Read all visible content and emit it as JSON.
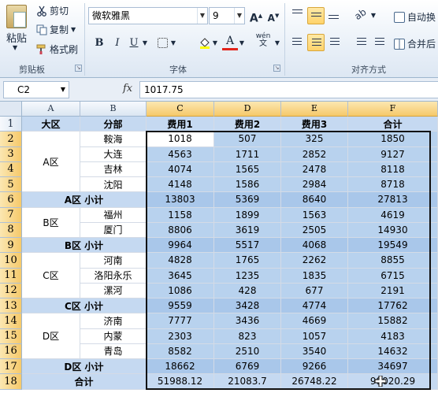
{
  "ribbon": {
    "clipboard": {
      "paste": "粘贴",
      "cut": "剪切",
      "copy": "复制",
      "painter": "格式刷",
      "label": "剪贴板"
    },
    "font": {
      "name": "微软雅黑",
      "size": "9",
      "bold": "B",
      "italic": "I",
      "underline": "U",
      "grow": "A",
      "shrink": "A",
      "label": "字体",
      "wen": "wén"
    },
    "alignment": {
      "wrap": "自动换",
      "merge": "合并后",
      "label": "对齐方式"
    }
  },
  "formula_bar": {
    "name_box": "C2",
    "fx": "fx",
    "value": "1017.75"
  },
  "columns": [
    "A",
    "B",
    "C",
    "D",
    "E",
    "F"
  ],
  "rows": [
    "1",
    "2",
    "3",
    "4",
    "5",
    "6",
    "7",
    "8",
    "9",
    "10",
    "11",
    "12",
    "13",
    "14",
    "15",
    "16",
    "17",
    "18"
  ],
  "header": [
    "大区",
    "分部",
    "费用1",
    "费用2",
    "费用3",
    "合计"
  ],
  "regions": [
    "A区",
    "B区",
    "C区",
    "D区"
  ],
  "body": [
    [
      "",
      "鞍海",
      "1018",
      "507",
      "325",
      "1850"
    ],
    [
      "",
      "大连",
      "4563",
      "1711",
      "2852",
      "9127"
    ],
    [
      "",
      "吉林",
      "4074",
      "1565",
      "2478",
      "8118"
    ],
    [
      "",
      "沈阳",
      "4148",
      "1586",
      "2984",
      "8718"
    ],
    [
      "A区 小计",
      "",
      "13803",
      "5369",
      "8640",
      "27813"
    ],
    [
      "",
      "福州",
      "1158",
      "1899",
      "1563",
      "4619"
    ],
    [
      "",
      "厦门",
      "8806",
      "3619",
      "2505",
      "14930"
    ],
    [
      "B区 小计",
      "",
      "9964",
      "5517",
      "4068",
      "19549"
    ],
    [
      "",
      "河南",
      "4828",
      "1765",
      "2262",
      "8855"
    ],
    [
      "",
      "洛阳永乐",
      "3645",
      "1235",
      "1835",
      "6715"
    ],
    [
      "",
      "漯河",
      "1086",
      "428",
      "677",
      "2191"
    ],
    [
      "C区 小计",
      "",
      "9559",
      "3428",
      "4774",
      "17762"
    ],
    [
      "",
      "济南",
      "7777",
      "3436",
      "4669",
      "15882"
    ],
    [
      "",
      "内蒙",
      "2303",
      "823",
      "1057",
      "4183"
    ],
    [
      "",
      "青岛",
      "8582",
      "2510",
      "3540",
      "14632"
    ],
    [
      "D区 小计",
      "",
      "18662",
      "6769",
      "9266",
      "34697"
    ],
    [
      "合计",
      "",
      "51988.12",
      "21083.7",
      "26748.22",
      "99020.29"
    ]
  ]
}
